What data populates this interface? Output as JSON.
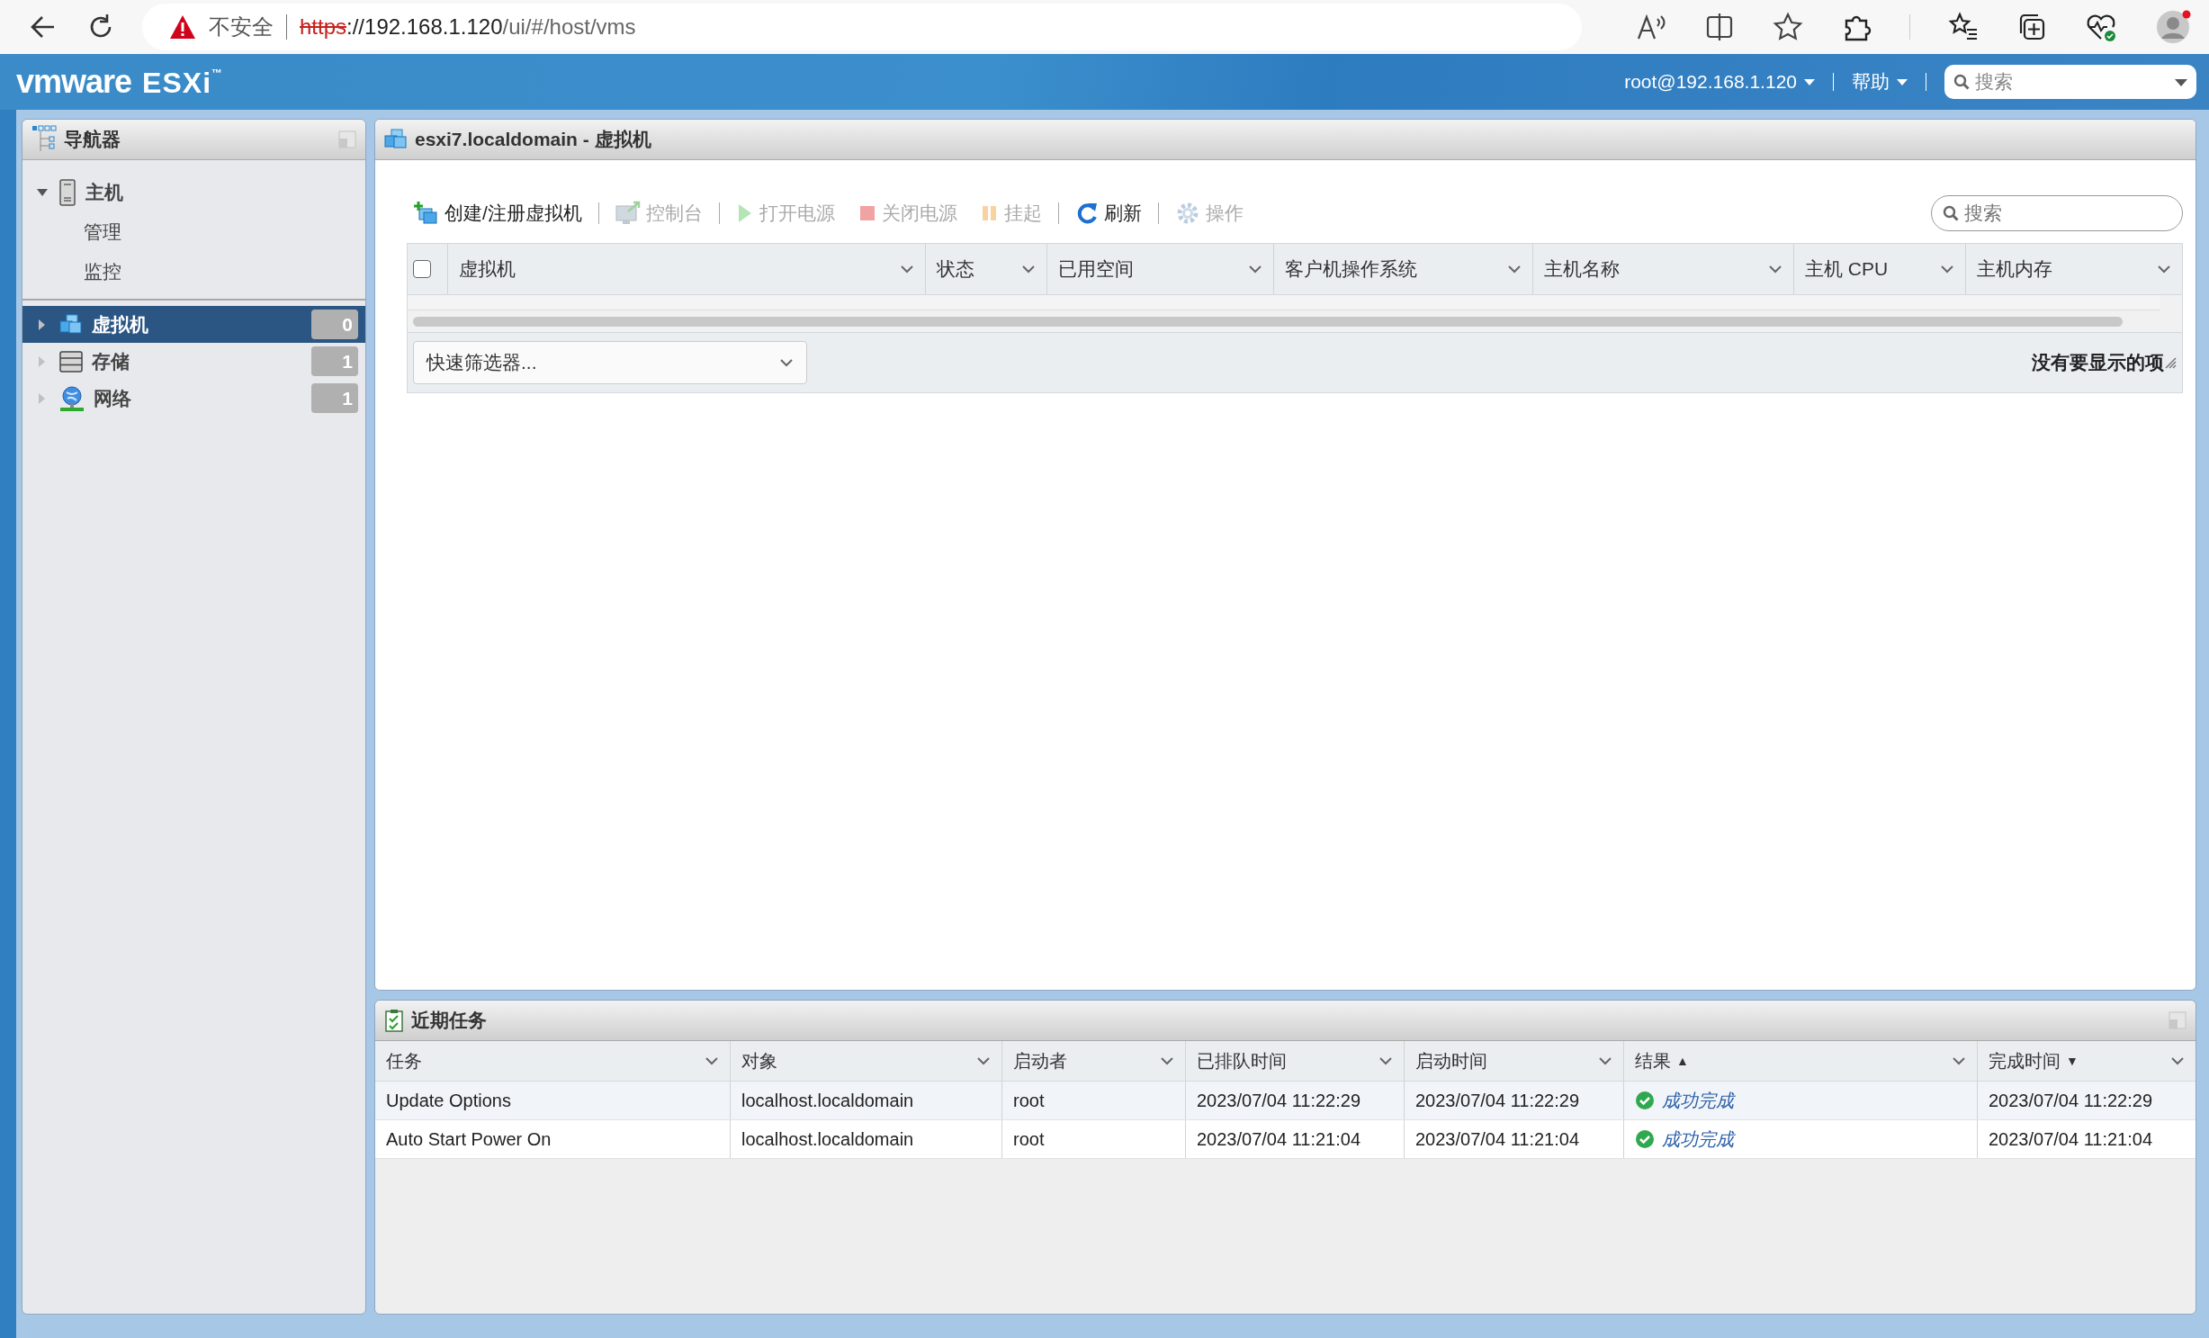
{
  "browser": {
    "security_label": "不安全",
    "url": {
      "scheme": "https",
      "host": "://192.168.1.120",
      "path": "/ui/#/host/vms"
    }
  },
  "header": {
    "logo": "vmware",
    "product": "ESXi",
    "trademark": "™",
    "user_menu": "root@192.168.1.120",
    "help_menu": "帮助",
    "search": {
      "placeholder": "搜索"
    }
  },
  "navigator": {
    "title": "导航器",
    "tree": [
      {
        "label": "主机",
        "kind": "host",
        "expanded": true,
        "selected": false,
        "children": [
          {
            "label": "管理",
            "selected": false
          },
          {
            "label": "监控",
            "selected": false
          }
        ]
      }
    ],
    "inventory": [
      {
        "label": "虚拟机",
        "kind": "vm",
        "selected": true,
        "count": "0"
      },
      {
        "label": "存储",
        "kind": "storage",
        "selected": false,
        "count": "1"
      },
      {
        "label": "网络",
        "kind": "network",
        "selected": false,
        "count": "1"
      }
    ]
  },
  "main": {
    "title": "esxi7.localdomain - 虚拟机",
    "toolbar": [
      [
        {
          "label": "创建/注册虚拟机",
          "kind": "create",
          "disabled": false
        }
      ],
      [
        {
          "label": "控制台",
          "kind": "console",
          "disabled": true
        }
      ],
      [
        {
          "label": "打开电源",
          "kind": "power-on",
          "disabled": true
        },
        {
          "label": "关闭电源",
          "kind": "power-off",
          "disabled": true
        },
        {
          "label": "挂起",
          "kind": "suspend",
          "disabled": true
        }
      ],
      [
        {
          "label": "刷新",
          "kind": "refresh",
          "disabled": false
        }
      ],
      [
        {
          "label": "操作",
          "kind": "actions",
          "disabled": true
        }
      ]
    ],
    "search": {
      "placeholder": "搜索"
    },
    "select_all": {
      "checked": false
    },
    "columns": [
      "虚拟机",
      "状态",
      "已用空间",
      "客户机操作系统",
      "主机名称",
      "主机 CPU",
      "主机内存"
    ],
    "quick_filter": {
      "value": "快速筛选器..."
    },
    "status": "没有要显示的项"
  },
  "tasks": {
    "title": "近期任务",
    "columns": [
      {
        "label": "任务"
      },
      {
        "label": "对象"
      },
      {
        "label": "启动者"
      },
      {
        "label": "已排队时间"
      },
      {
        "label": "启动时间"
      },
      {
        "label": "结果",
        "sort_mark": "▲"
      },
      {
        "label": "完成时间",
        "sort_mark": "▼"
      }
    ],
    "rows": [
      {
        "task": "Update Options",
        "object": "localhost.localdomain",
        "initiator": "root",
        "queued": "2023/07/04 11:22:29",
        "started": "2023/07/04 11:22:29",
        "result": {
          "label": "成功完成",
          "kind": "success"
        },
        "completed": "2023/07/04 11:22:29"
      },
      {
        "task": "Auto Start Power On",
        "object": "localhost.localdomain",
        "initiator": "root",
        "queued": "2023/07/04 11:21:04",
        "started": "2023/07/04 11:21:04",
        "result": {
          "label": "成功完成",
          "kind": "success"
        },
        "completed": "2023/07/04 11:21:04"
      }
    ]
  }
}
